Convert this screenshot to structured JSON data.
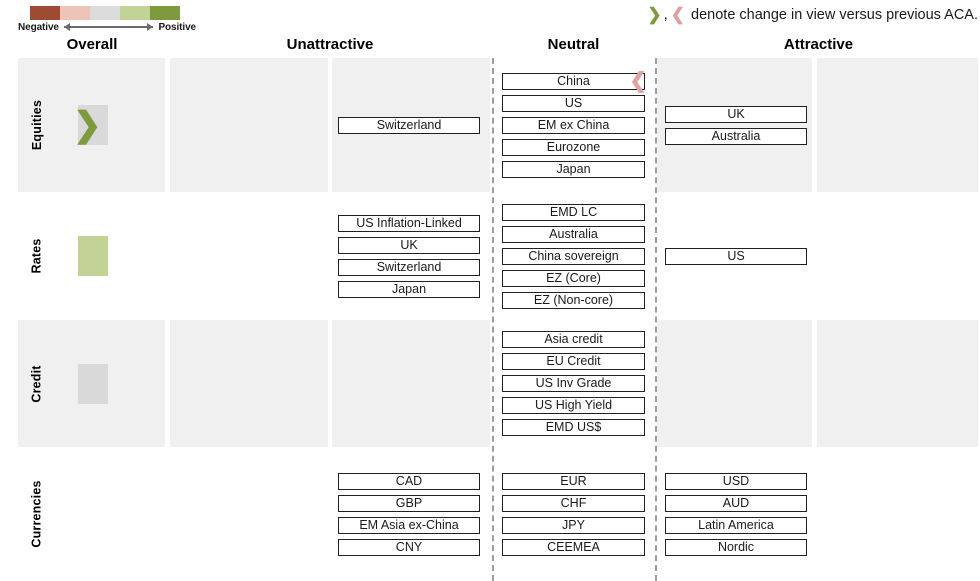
{
  "legend": {
    "negative_label": "Negative",
    "positive_label": "Positive",
    "colors": [
      "#9e4b34",
      "#eec3b8",
      "#dcdcdc",
      "#c3d396",
      "#7d9a3e"
    ]
  },
  "note": {
    "up_chevron": "❯",
    "comma": ",",
    "down_chevron": "❮",
    "text": "denote change in view versus previous ACA."
  },
  "headers": {
    "overall": "Overall",
    "unattractive": "Unattractive",
    "neutral": "Neutral",
    "attractive": "Attractive"
  },
  "rows": [
    {
      "label": "Equities",
      "shaded": true,
      "overall": {
        "color": "#d9d9d9",
        "chevron": "❯",
        "chevron_color": "#7d9a3e"
      },
      "unattractive": [
        {
          "label": "Switzerland"
        }
      ],
      "neutral": [
        {
          "label": "China",
          "mark": "❮",
          "mark_dir": "down"
        },
        {
          "label": "US"
        },
        {
          "label": "EM ex China"
        },
        {
          "label": "Eurozone"
        },
        {
          "label": "Japan"
        }
      ],
      "attractive": [
        {
          "label": "UK"
        },
        {
          "label": "Australia"
        }
      ]
    },
    {
      "label": "Rates",
      "shaded": false,
      "overall": {
        "color": "#c3d396",
        "chevron": "",
        "chevron_color": ""
      },
      "unattractive": [
        {
          "label": "US Inflation-Linked"
        },
        {
          "label": "UK"
        },
        {
          "label": "Switzerland"
        },
        {
          "label": "Japan"
        }
      ],
      "neutral": [
        {
          "label": "EMD LC"
        },
        {
          "label": "Australia"
        },
        {
          "label": "China sovereign"
        },
        {
          "label": "EZ (Core)"
        },
        {
          "label": "EZ (Non-core)"
        }
      ],
      "attractive": [
        {
          "label": "US"
        }
      ]
    },
    {
      "label": "Credit",
      "shaded": true,
      "overall": {
        "color": "#d9d9d9",
        "chevron": "",
        "chevron_color": ""
      },
      "unattractive": [],
      "neutral": [
        {
          "label": "Asia credit"
        },
        {
          "label": "EU Credit"
        },
        {
          "label": "US Inv Grade"
        },
        {
          "label": "US High Yield"
        },
        {
          "label": "EMD US$"
        }
      ],
      "attractive": []
    },
    {
      "label": "Currencies",
      "shaded": false,
      "overall": {
        "color": "",
        "chevron": "",
        "chevron_color": ""
      },
      "unattractive": [
        {
          "label": "CAD"
        },
        {
          "label": "GBP"
        },
        {
          "label": "EM Asia ex-China"
        },
        {
          "label": "CNY"
        }
      ],
      "neutral": [
        {
          "label": "EUR"
        },
        {
          "label": "CHF"
        },
        {
          "label": "JPY"
        },
        {
          "label": "CEEMEA"
        }
      ],
      "attractive": [
        {
          "label": "USD"
        },
        {
          "label": "AUD"
        },
        {
          "label": "Latin America"
        },
        {
          "label": "Nordic"
        }
      ]
    }
  ]
}
